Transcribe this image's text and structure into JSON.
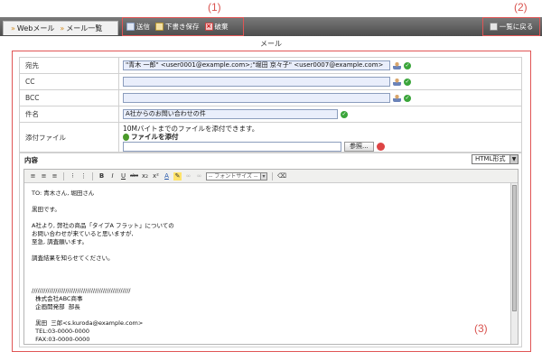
{
  "annotations": {
    "a1": "(1)",
    "a2": "(2)",
    "a3": "(3)"
  },
  "breadcrumb": {
    "item1": "Webメール",
    "item2": "メール一覧"
  },
  "toolbar": {
    "send": "送信",
    "save_draft": "下書き保存",
    "discard": "破棄",
    "back_to_list": "一覧に戻る"
  },
  "mail_title": "メール",
  "form": {
    "to_label": "宛先",
    "to_value": "\"青木 一郎\" <user0001@example.com>;\"堀田 京々子\" <user0007@example.com>",
    "cc_label": "CC",
    "cc_value": "",
    "bcc_label": "BCC",
    "bcc_value": "",
    "subject_label": "件名",
    "subject_value": "A社からのお問い合わせの件",
    "attach_label": "添付ファイル",
    "attach_note": "10Mバイトまでのファイルを添付できます。",
    "attach_link": "ファイルを添付",
    "attach_value": "",
    "browse_button": "参照...",
    "content_label": "内容",
    "format_select": "HTML形式",
    "font_size_select": "-- フォントサイズ --"
  },
  "body_text": "TO: 青木さん, 堀田さん\n\n黒田です。\n\nA社より, 弊社の商品「タイプA フラット」についての\nお問い合わせが来ていると思いますが,\n至急, 調査願います。\n\n調査結果を知らせてください。\n\n\n\n//////////////////////////////////////////////////\n  株式会社ABC商事\n  企画開発部  部長\n\n  黒田  三郎<s.kuroda@example.com>\n  TEL:03-0000-0000\n  FAX:03-0000-0000",
  "colors": {
    "accent_border": "#e05555",
    "topbar": "#5a5a5a",
    "input_bg": "#e9eefb"
  }
}
